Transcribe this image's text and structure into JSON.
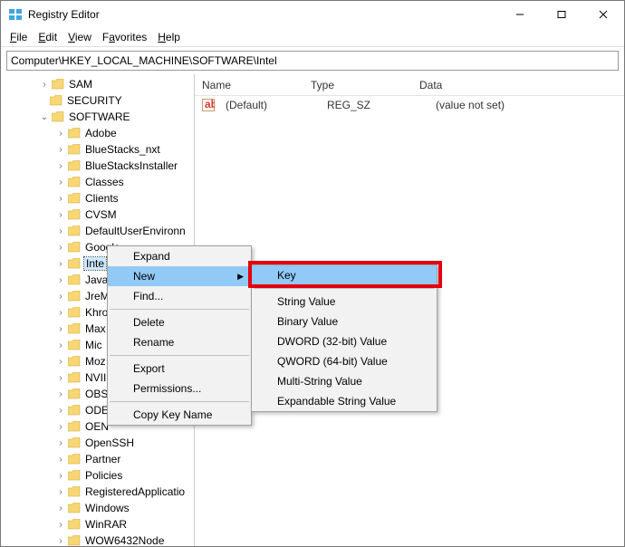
{
  "title": "Registry Editor",
  "menus": {
    "file": "File",
    "edit": "Edit",
    "view": "View",
    "favorites": "Favorites",
    "help": "Help"
  },
  "address": "Computer\\HKEY_LOCAL_MACHINE\\SOFTWARE\\Intel",
  "columns": {
    "name": "Name",
    "type": "Type",
    "data": "Data"
  },
  "row": {
    "name": "(Default)",
    "type": "REG_SZ",
    "data": "(value not set)"
  },
  "tree": {
    "sam": "SAM",
    "security": "SECURITY",
    "software": "SOFTWARE",
    "items": [
      "Adobe",
      "BlueStacks_nxt",
      "BlueStacksInstaller",
      "Classes",
      "Clients",
      "CVSM",
      "DefaultUserEnvironment",
      "Google",
      "Intel",
      "JavaSoft",
      "JreMetrics",
      "Khronos",
      "Maxon",
      "Microsoft",
      "Mozilla",
      "NVIDIA Corporation",
      "OBS Studio",
      "ODBC",
      "OEM",
      "OpenSSH",
      "Partner",
      "Policies",
      "RegisteredApplications",
      "Windows",
      "WinRAR",
      "WOW6432Node"
    ],
    "truncated": [
      "Inte",
      "Java",
      "JreM",
      "Khro",
      "Max",
      "Mic",
      "Moz",
      "NVII",
      "OBS",
      "ODE",
      "OEN",
      "OpenSSH",
      "Partner",
      "Policies",
      "RegisteredApplicatio",
      "Windows",
      "WinRAR",
      "WOW6432Node"
    ]
  },
  "ctx1": {
    "expand": "Expand",
    "new": "New",
    "find": "Find...",
    "delete": "Delete",
    "rename": "Rename",
    "export": "Export",
    "permissions": "Permissions...",
    "copy": "Copy Key Name"
  },
  "ctx2": {
    "key": "Key",
    "string": "String Value",
    "binary": "Binary Value",
    "dword": "DWORD (32-bit) Value",
    "qword": "QWORD (64-bit) Value",
    "multi": "Multi-String Value",
    "expand": "Expandable String Value"
  }
}
